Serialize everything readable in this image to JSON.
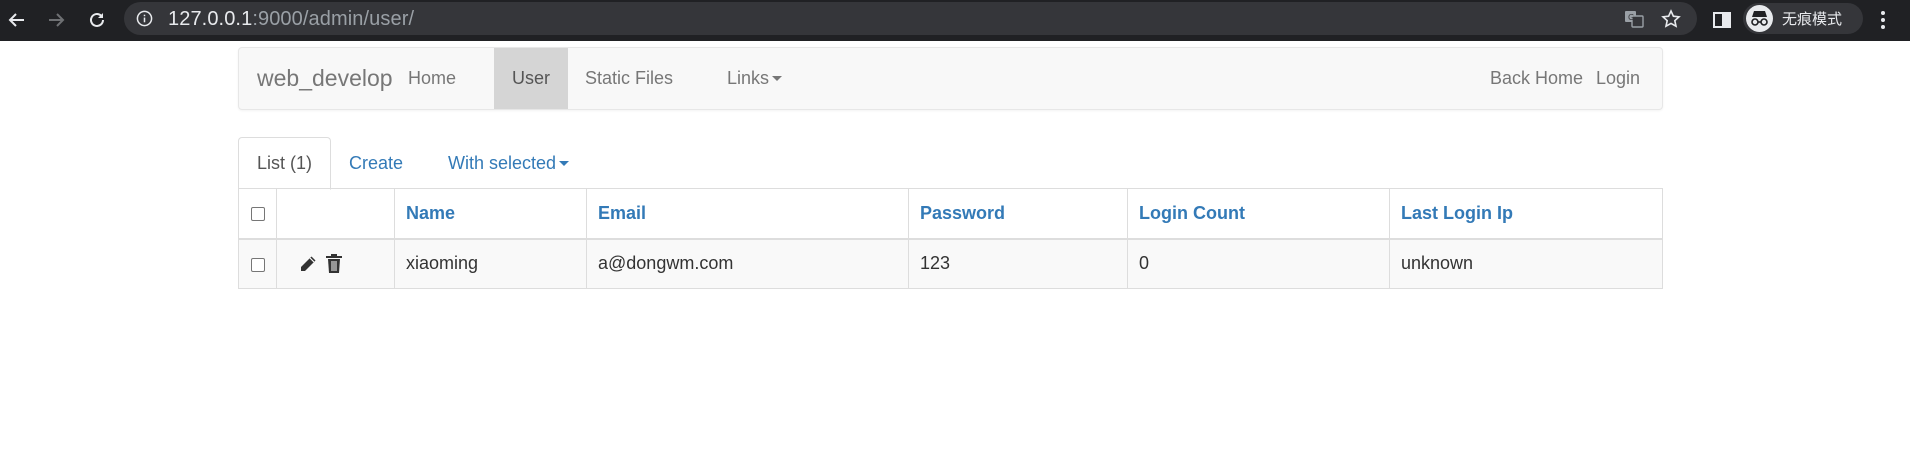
{
  "browser": {
    "url_host": "127.0.0.1",
    "url_rest": ":9000/admin/user/",
    "incognito_label": "无痕模式"
  },
  "navbar": {
    "brand": "web_develop",
    "items": [
      {
        "label": "Home"
      },
      {
        "label": "User"
      },
      {
        "label": "Static Files"
      },
      {
        "label": "Links"
      }
    ],
    "right_items": [
      {
        "label": "Back Home"
      },
      {
        "label": "Login"
      }
    ]
  },
  "tabs": {
    "list_label": "List (1)",
    "create_label": "Create",
    "with_selected_label": "With selected"
  },
  "table": {
    "columns": [
      "Name",
      "Email",
      "Password",
      "Login Count",
      "Last Login Ip"
    ],
    "rows": [
      {
        "name": "xiaoming",
        "email": "a@dongwm.com",
        "password": "123",
        "login_count": "0",
        "last_login_ip": "unknown"
      }
    ]
  },
  "colors": {
    "link": "#337ab7",
    "navbar_bg": "#f8f8f8",
    "active_nav_bg": "#d5d5d5",
    "chrome_bg": "#202124"
  }
}
